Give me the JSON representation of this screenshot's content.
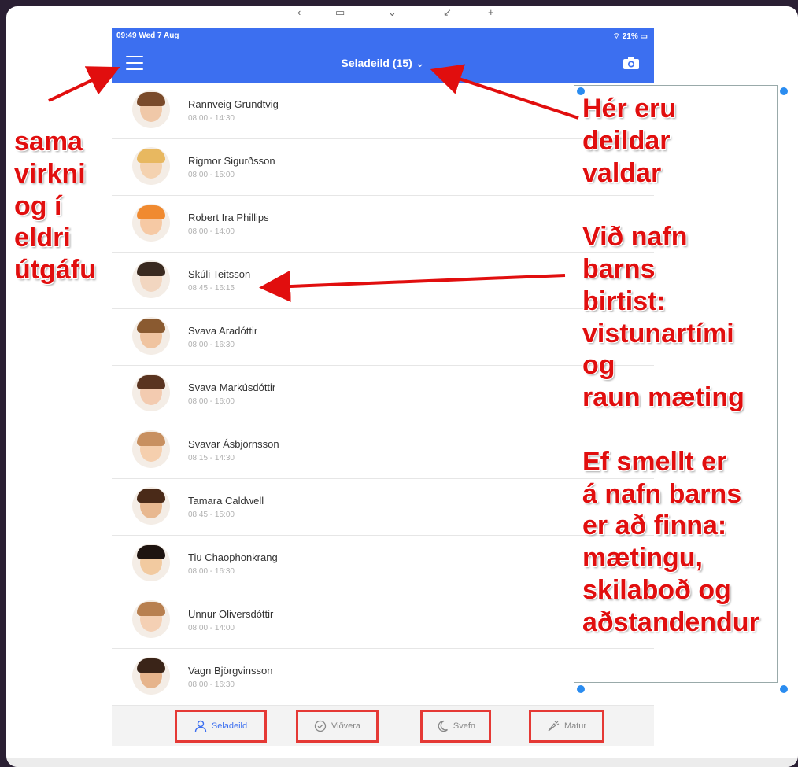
{
  "status_bar": {
    "time": "09:49  Wed 7 Aug",
    "battery": "21%"
  },
  "navbar": {
    "title": "Seladeild (15)"
  },
  "children": [
    {
      "name": "Rannveig Grundtvig",
      "time": "08:00 - 14:30",
      "skin": "#f0c8a8",
      "hair": "#7a4a2a"
    },
    {
      "name": "Rigmor Sigurðsson",
      "time": "08:00 - 15:00",
      "skin": "#f4d2b0",
      "hair": "#e8b860"
    },
    {
      "name": "Robert Ira Phillips",
      "time": "08:00 - 14:00",
      "skin": "#f6c9a4",
      "hair": "#f08a30"
    },
    {
      "name": "Skúli Teitsson",
      "time": "08:45 - 16:15",
      "skin": "#f2d6c0",
      "hair": "#3a2a20"
    },
    {
      "name": "Svava Aradóttir",
      "time": "08:00 - 16:30",
      "skin": "#f0c4a0",
      "hair": "#8a5a30"
    },
    {
      "name": "Svava Markúsdóttir",
      "time": "08:00 - 16:00",
      "skin": "#f3cbb0",
      "hair": "#5a3420"
    },
    {
      "name": "Svavar Ásbjörnsson",
      "time": "08:15 - 14:30",
      "skin": "#f5cfae",
      "hair": "#c89060"
    },
    {
      "name": "Tamara Caldwell",
      "time": "08:45 - 15:00",
      "skin": "#e8b890",
      "hair": "#4a2a18"
    },
    {
      "name": "Tiu Chaophonkrang",
      "time": "08:00 - 16:30",
      "skin": "#f2caa0",
      "hair": "#1e1410"
    },
    {
      "name": "Unnur Oliversdóttir",
      "time": "08:00 - 14:00",
      "skin": "#f4d0b4",
      "hair": "#b88050"
    },
    {
      "name": "Vagn Björgvinsson",
      "time": "08:00 - 16:30",
      "skin": "#e6b48c",
      "hair": "#3a2418"
    }
  ],
  "tabs": {
    "seladeild": "Seladeild",
    "vidvera": "Viðvera",
    "svefn": "Svefn",
    "matur": "Matur"
  },
  "annotations": {
    "left": [
      "sama",
      "virkni",
      "og í",
      "eldri",
      "útgáfu"
    ],
    "right": [
      "Hér eru",
      "deildar",
      "valdar",
      "",
      "Við nafn",
      "barns",
      "birtist:",
      "vistunartími",
      "og",
      "raun mæting",
      "",
      "Ef smellt er",
      "á nafn barns",
      "er að finna:",
      "mætingu,",
      "skilaboð og",
      "aðstandendur"
    ]
  },
  "colors": {
    "brand_blue": "#3c6ff0",
    "annotation_red": "#e10e0e"
  }
}
